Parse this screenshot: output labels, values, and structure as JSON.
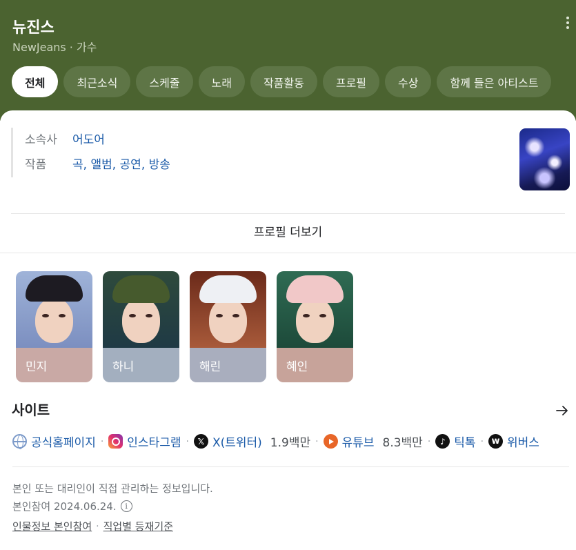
{
  "header": {
    "title": "뉴진스",
    "subtitle_name": "NewJeans",
    "subtitle_sep": "·",
    "subtitle_type": "가수",
    "colors": {
      "background": "#4b6330",
      "tab": "#5e7546"
    }
  },
  "tabs": [
    {
      "label": "전체",
      "active": true
    },
    {
      "label": "최근소식"
    },
    {
      "label": "스케줄"
    },
    {
      "label": "노래"
    },
    {
      "label": "작품활동"
    },
    {
      "label": "프로필"
    },
    {
      "label": "수상"
    },
    {
      "label": "함께 들은 아티스트"
    }
  ],
  "info": {
    "agency_label": "소속사",
    "agency_value": "어도어",
    "works_label": "작품",
    "works": [
      "곡",
      "앨범",
      "공연",
      "방송"
    ],
    "works_sep": ","
  },
  "profile_more": "프로필 더보기",
  "members": [
    {
      "name": "민지"
    },
    {
      "name": "하니"
    },
    {
      "name": "해린"
    },
    {
      "name": "혜인"
    }
  ],
  "sites": {
    "title": "사이트",
    "links": [
      {
        "label": "공식홈페이지",
        "icon": "globe-icon"
      },
      {
        "label": "인스타그램",
        "icon": "instagram-icon"
      },
      {
        "label": "X(트위터)",
        "icon": "x-twitter-icon",
        "count": "1.9백만",
        "icon_glyph": "𝕏"
      },
      {
        "label": "유튜브",
        "icon": "youtube-icon",
        "count": "8.3백만"
      },
      {
        "label": "틱톡",
        "icon": "tiktok-icon",
        "icon_glyph": "♪"
      },
      {
        "label": "위버스",
        "icon": "weverse-icon",
        "icon_glyph": "w"
      }
    ]
  },
  "footer": {
    "notice": "본인 또는 대리인이 직접 관리하는 정보입니다.",
    "participation": "본인참여 2024.06.24.",
    "info_glyph": "i",
    "link1": "인물정보 본인참여",
    "link2": "직업별 등재기준",
    "sep": "·"
  }
}
